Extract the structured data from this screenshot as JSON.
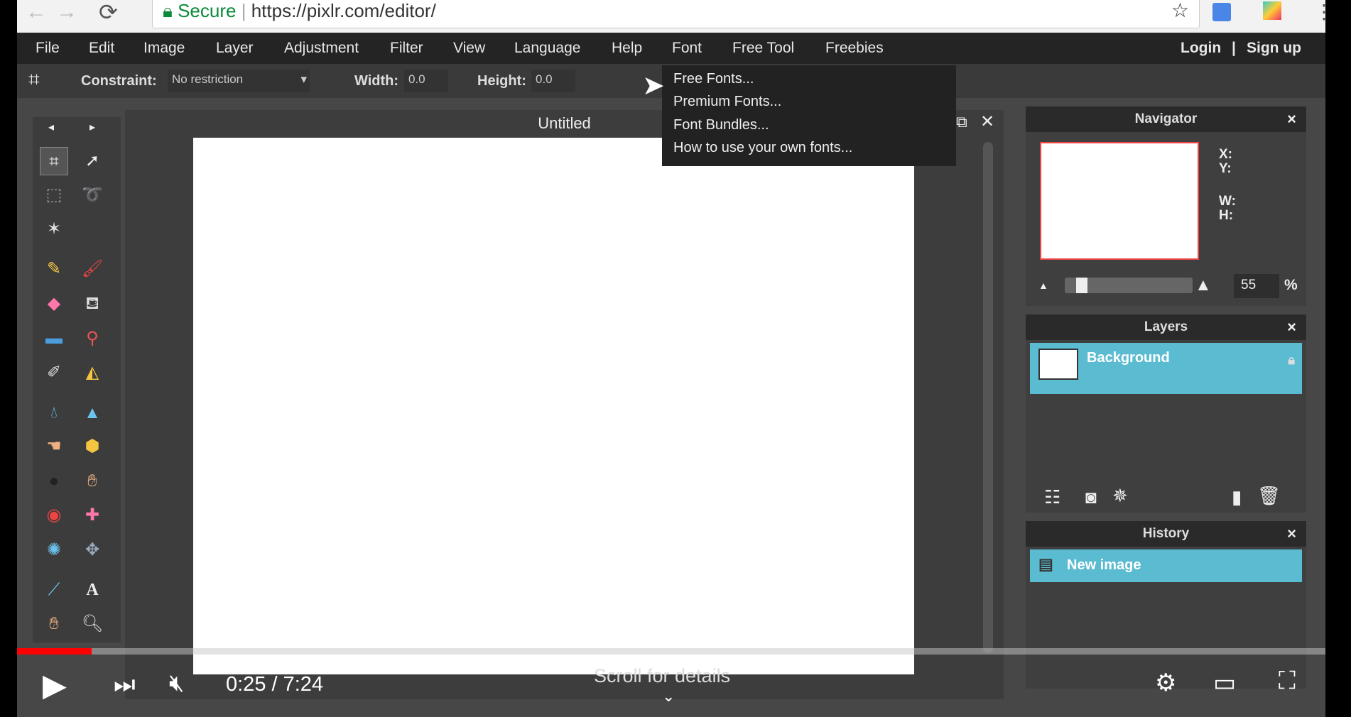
{
  "browser": {
    "secure_label": "Secure",
    "url": "https://pixlr.com/editor/"
  },
  "menubar": {
    "items": [
      "File",
      "Edit",
      "Image",
      "Layer",
      "Adjustment",
      "Filter",
      "View",
      "Language",
      "Help",
      "Font",
      "Free Tool",
      "Freebies"
    ],
    "login": "Login",
    "separator": "|",
    "signup": "Sign up"
  },
  "toolbar": {
    "constraint_label": "Constraint:",
    "constraint_value": "No restriction",
    "width_label": "Width:",
    "width_value": "0.0",
    "height_label": "Height:",
    "height_value": "0.0"
  },
  "font_menu": {
    "items": [
      "Free Fonts...",
      "Premium Fonts...",
      "Font Bundles...",
      "How to use your own fonts..."
    ]
  },
  "document": {
    "title": "Untitled"
  },
  "navigator": {
    "title": "Navigator",
    "x_label": "X:",
    "y_label": "Y:",
    "w_label": "W:",
    "h_label": "H:",
    "zoom_value": "55",
    "zoom_unit": "%",
    "zoom_slider_fraction": 0.1
  },
  "layers": {
    "title": "Layers",
    "items": [
      {
        "name": "Background",
        "locked": true
      }
    ]
  },
  "history": {
    "title": "History",
    "items": [
      "New image"
    ]
  },
  "video": {
    "time": "0:25 / 7:24",
    "progress_fraction": 0.057,
    "scroll_hint": "Scroll for details"
  },
  "colors": {
    "accent": "#5bbcd1",
    "progress": "#ff0000",
    "menubar": "#242424"
  }
}
